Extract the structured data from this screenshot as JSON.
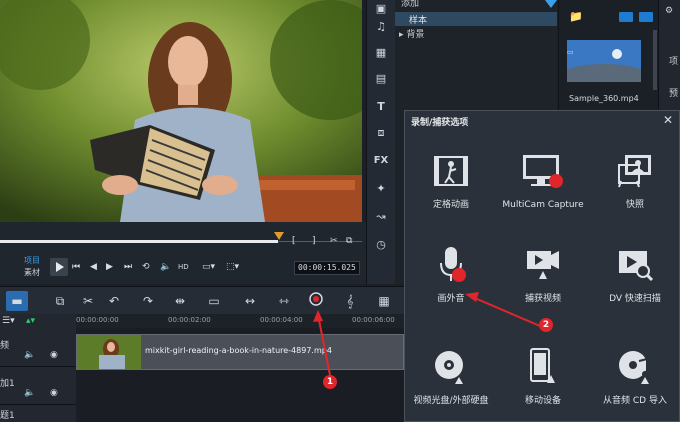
{
  "library": {
    "partial_top_label": "添加",
    "items": [
      "样本",
      "背景"
    ]
  },
  "media": {
    "thumbnail_label": "Sample_360.mp4"
  },
  "farright": {
    "labels": [
      "项",
      "预"
    ]
  },
  "player": {
    "mode_project": "项目",
    "mode_clip": "素材",
    "timecode": "00:00:15.025"
  },
  "timeline": {
    "ruler_ticks": [
      "00:00:00:00",
      "00:00:02:00",
      "00:00:04:00",
      "00:00:06:00"
    ],
    "clip_label": "mixkit-girl-reading-a-book-in-nature-4897.mp4",
    "track_labels": [
      "频",
      "加1",
      "题1"
    ]
  },
  "dialog": {
    "title": "录制/捕获选项",
    "options": [
      {
        "label": "定格动画",
        "icon": "stop-motion-icon"
      },
      {
        "label": "MultiCam Capture",
        "icon": "multicam-monitor-icon"
      },
      {
        "label": "快照",
        "icon": "snapshot-icon"
      },
      {
        "label": "画外音",
        "icon": "microphone-icon"
      },
      {
        "label": "捕获视频",
        "icon": "capture-video-icon"
      },
      {
        "label": "DV 快速扫描",
        "icon": "dv-scan-icon"
      },
      {
        "label": "视频光盘/外部硬盘",
        "icon": "disc-icon"
      },
      {
        "label": "移动设备",
        "icon": "mobile-device-icon"
      },
      {
        "label": "从音频 CD 导入",
        "icon": "audio-cd-icon"
      }
    ]
  },
  "annotations": {
    "badge1": "1",
    "badge2": "2",
    "arrow_color": "#e0262b"
  }
}
